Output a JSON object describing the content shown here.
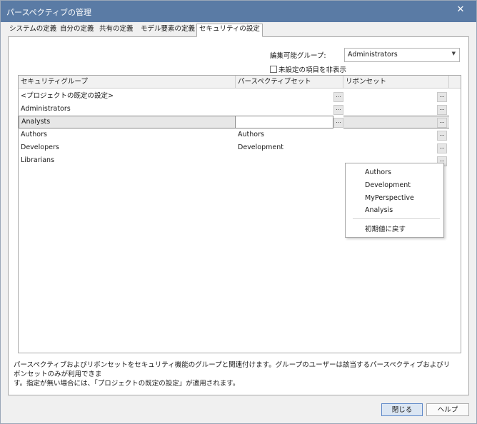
{
  "window": {
    "title": "パースペクティブの管理",
    "close_glyph": "✕"
  },
  "tabs": [
    {
      "label": "システムの定義"
    },
    {
      "label": "自分の定義"
    },
    {
      "label": "共有の定義"
    },
    {
      "label": "モデル要素の定義"
    },
    {
      "label": "セキュリティの設定",
      "active": true
    }
  ],
  "settings": {
    "editable_group_label": "編集可能グループ:",
    "editable_group_value": "Administrators",
    "hide_unset_label": "未設定の項目を非表示",
    "hide_unset_checked": false
  },
  "grid": {
    "headers": [
      "セキュリティグループ",
      "パースペクティブセット",
      "リボンセット"
    ],
    "ellipsis": "...",
    "rows": [
      {
        "group": "<プロジェクトの既定の設定>",
        "perspective": "",
        "ribbon": ""
      },
      {
        "group": "Administrators",
        "perspective": "",
        "ribbon": ""
      },
      {
        "group": "Analysts",
        "perspective": "",
        "ribbon": "",
        "selected": true
      },
      {
        "group": "Authors",
        "perspective": "Authors",
        "ribbon": ""
      },
      {
        "group": "Developers",
        "perspective": "Development",
        "ribbon": ""
      },
      {
        "group": "Librarians",
        "perspective": "",
        "ribbon": ""
      }
    ]
  },
  "dropdown": {
    "items": [
      "Authors",
      "Development",
      "MyPerspective",
      "Analysis"
    ],
    "reset_label": "初期値に戻す"
  },
  "description": {
    "line1": "パースペクティブおよびリボンセットをセキュリティ機能のグループと関連付けます。グループのユーザーは該当するパースペクティブおよびリボンセットのみが利用できま",
    "line2": "す。指定が無い場合には、「プロジェクトの既定の設定」が適用されます。"
  },
  "buttons": {
    "close": "閉じる",
    "help": "ヘルプ"
  },
  "colors": {
    "titlebar": "#5a7ba5",
    "accent_button": "#dbe6f3",
    "selection": "#e7e7e7"
  }
}
